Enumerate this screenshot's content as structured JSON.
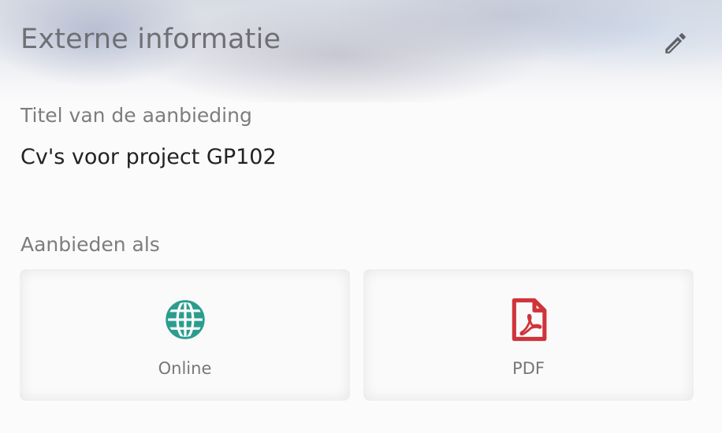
{
  "header": {
    "title": "Externe informatie"
  },
  "offer_title": {
    "label": "Titel van de aanbieding",
    "value": "Cv's voor project GP102"
  },
  "offer_as": {
    "label": "Aanbieden als",
    "options": [
      {
        "label": "Online",
        "icon": "globe-icon",
        "color": "#2a9d8f"
      },
      {
        "label": "PDF",
        "icon": "pdf-file-icon",
        "color": "#d0343a"
      }
    ]
  },
  "icons": {
    "edit": "pencil-icon"
  }
}
